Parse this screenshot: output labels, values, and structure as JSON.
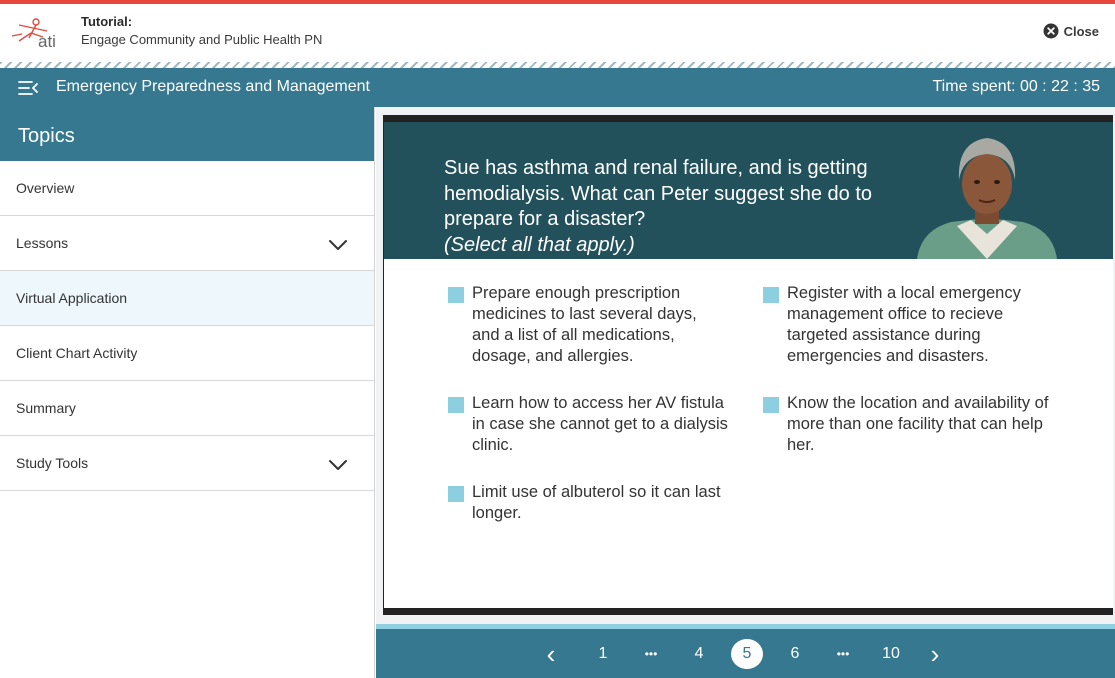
{
  "app": {
    "tutorial_label": "Tutorial:",
    "tutorial_name": "Engage Community and Public Health PN",
    "logo_text": "ati",
    "close_label": "Close"
  },
  "header": {
    "title": "Emergency Preparedness and Management",
    "time_spent": "Time spent: 00 : 22 : 35"
  },
  "sidebar": {
    "title": "Topics",
    "items": [
      {
        "label": "Overview"
      },
      {
        "label": "Lessons"
      },
      {
        "label": "Virtual Application"
      },
      {
        "label": "Client Chart Activity"
      },
      {
        "label": "Summary"
      },
      {
        "label": "Study Tools"
      }
    ]
  },
  "slide": {
    "question": "Sue has asthma and renal failure, and is getting hemodialysis. What can Peter suggest she do to prepare for a disaster?",
    "instruction": "(Select all that apply.)",
    "options": [
      "Prepare enough prescription medicines to last several days, and a list of all medications, dosage, and allergies.",
      "Register with a local emergency management office to recieve targeted assistance during emergencies and disasters.",
      "Learn how to access her AV fistula in case she cannot get to a dialysis clinic.",
      "Know the location and availability of more than one facility that can help her.",
      "Limit use of albuterol so it can last longer."
    ]
  },
  "pagination": {
    "prev": "‹",
    "next": "›",
    "pages": [
      "1",
      "•••",
      "4",
      "5",
      "6",
      "•••",
      "10"
    ],
    "current": "5"
  },
  "colors": {
    "accent": "#e8483b",
    "header": "#35788f",
    "banner": "#22515b",
    "checkbox": "#8ccfe0"
  }
}
